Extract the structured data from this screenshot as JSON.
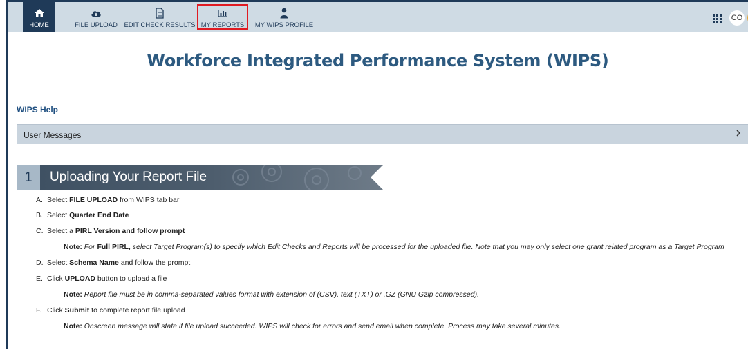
{
  "nav": {
    "home": "HOME",
    "file_upload": "FILE UPLOAD",
    "edit_check": "EDIT CHECK RESULTS",
    "my_reports": "MY REPORTS",
    "my_profile": "MY WIPS PROFILE",
    "user_initials": "CO"
  },
  "page": {
    "title": "Workforce Integrated Performance System (WIPS)",
    "help_link": "WIPS Help",
    "user_messages": "User Messages"
  },
  "section": {
    "number": "1",
    "title": "Uploading Your Report File"
  },
  "steps": {
    "a": {
      "letter": "A.",
      "pre": "Select ",
      "bold": "FILE UPLOAD",
      "post": " from WIPS tab bar"
    },
    "b": {
      "letter": "B.",
      "pre": "Select ",
      "bold": "Quarter End Date",
      "post": ""
    },
    "c": {
      "letter": "C.",
      "pre": "Select a ",
      "bold": "PIRL Version and follow prompt",
      "post": ""
    },
    "c_note": {
      "label": "Note:",
      "t1": " For ",
      "bold": "Full PIRL,",
      "t2": " select Target Program(s) to specify which Edit Checks and Reports will be processed for the uploaded file. Note that you may only select one grant related program as a Target Program"
    },
    "d": {
      "letter": "D.",
      "pre": "Select ",
      "bold": "Schema Name",
      "post": " and follow the prompt"
    },
    "e": {
      "letter": "E.",
      "pre": "Click ",
      "bold": "UPLOAD",
      "post": " button to upload a file"
    },
    "e_note": {
      "label": "Note:",
      "text": " Report file must be in comma-separated values format with extension of (CSV), text (TXT) or .GZ (GNU Gzip compressed)."
    },
    "f": {
      "letter": "F.",
      "pre": "Click ",
      "bold": "Submit",
      "post": " to complete report file upload"
    },
    "f_note": {
      "label": "Note:",
      "text": " Onscreen message will state if file upload succeeded. WIPS will check for errors and send email when complete. Process may take several minutes."
    }
  },
  "colors": {
    "navy": "#1f3a58",
    "title_blue": "#2d5a80",
    "nav_bg": "#cfdbe4",
    "highlight_red": "#e01b22"
  },
  "icons": [
    "home-icon",
    "cloud-upload-icon",
    "document-icon",
    "bar-chart-icon",
    "person-icon",
    "grid-icon",
    "chevron-right-icon",
    "gear-icon"
  ]
}
